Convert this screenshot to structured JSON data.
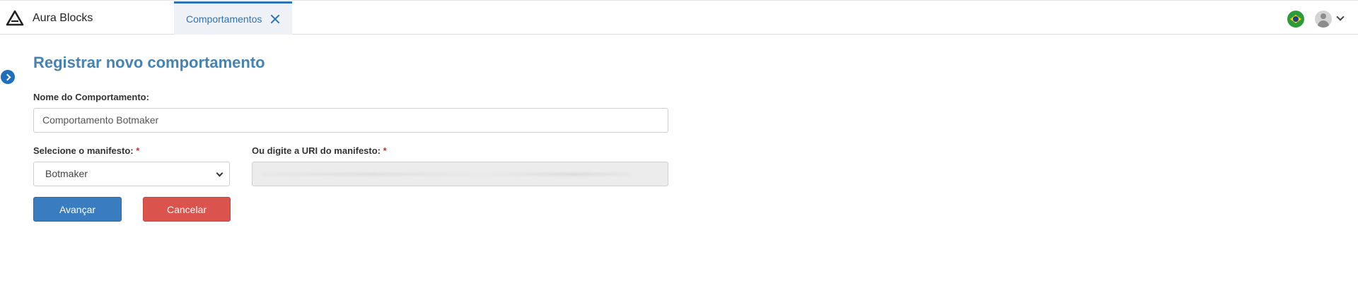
{
  "app": {
    "name": "Aura Blocks"
  },
  "tabs": [
    {
      "label": "Comportamentos",
      "active": true
    }
  ],
  "header": {
    "flag": "brazil-flag-icon",
    "avatar": "user-avatar-icon"
  },
  "page": {
    "title": "Registrar novo comportamento"
  },
  "form": {
    "name_label": "Nome do Comportamento:",
    "name_value": "Comportamento Botmaker",
    "manifest_label": "Selecione o manifesto:",
    "manifest_selected": "Botmaker",
    "uri_label": "Ou digite a URI do manifesto:",
    "required_mark": "*",
    "uri_value": ""
  },
  "buttons": {
    "next": "Avançar",
    "cancel": "Cancelar"
  },
  "colors": {
    "primary": "#3a7cc0",
    "danger": "#db534d",
    "title": "#4682b4",
    "tab_accent": "#2f72b8"
  }
}
